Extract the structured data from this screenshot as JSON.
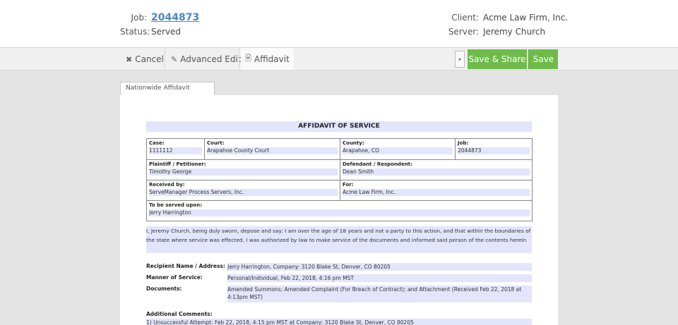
{
  "header": {
    "job_label": "Job:",
    "job_number": "2044873",
    "status_label": "Status:",
    "status_value": "Served",
    "client_label": "Client:",
    "client_value": "Acme Law Firm, Inc.",
    "server_label": "Server:",
    "server_value": "Jeremy Church"
  },
  "toolbar": {
    "cancel_label": "Cancel",
    "advanced_edit_label": "Advanced Edit",
    "affidavit_label": "Affidavit",
    "save_share_label": "Save & Share",
    "save_label": "Save"
  },
  "doc_tab": {
    "label": "Nationwide Affidavit"
  },
  "document": {
    "title": "AFFIDAVIT OF SERVICE",
    "case_label": "Case:",
    "case_value": "1111112",
    "court_label": "Court:",
    "court_value": "Arapahoe County Court",
    "county_label": "County:",
    "county_value": "Arapahoe, CO",
    "job_label": "Job:",
    "job_value": "2044873",
    "plaintiff_label": "Plaintiff / Petitioner:",
    "plaintiff_value": "Timothy George",
    "defendant_label": "Defendant / Respondent:",
    "defendant_value": "Dean Smith",
    "received_label": "Received by:",
    "received_value": "ServeManager Process Servers, Inc.",
    "for_label": "For:",
    "for_value": "Acme Law Firm, Inc.",
    "served_upon_label": "To be served upon:",
    "served_upon_value": "Jerry Harrington",
    "statement": "I, Jeremy Church, being duly sworn, depose and say: I am over the age of 18 years and not a party to this action, and that within the boundaries of the state where service was effected, I was authorized by law to make service of the documents and informed said person of the contents herein",
    "recipient_label": "Recipient Name / Address:",
    "recipient_value": "Jerry Harrington, Company: 3120 Blake St, Denver, CO 80205",
    "manner_label": "Manner of Service:",
    "manner_value": "Personal/Individual, Feb 22, 2018, 4:16 pm MST",
    "documents_label": "Documents:",
    "documents_value_line1": "Amended Summons; Amended Complaint (For Breach of Contract); and Attachment (Received Feb 22, 2018 at",
    "documents_value_line2": "4:13pm MST)",
    "additional_label": "Additional Comments:",
    "additional_value": "1) Unsuccessful Attempt: Feb 22, 2018, 4:15 pm MST at Company: 3120 Blake St, Denver, CO 80205"
  }
}
